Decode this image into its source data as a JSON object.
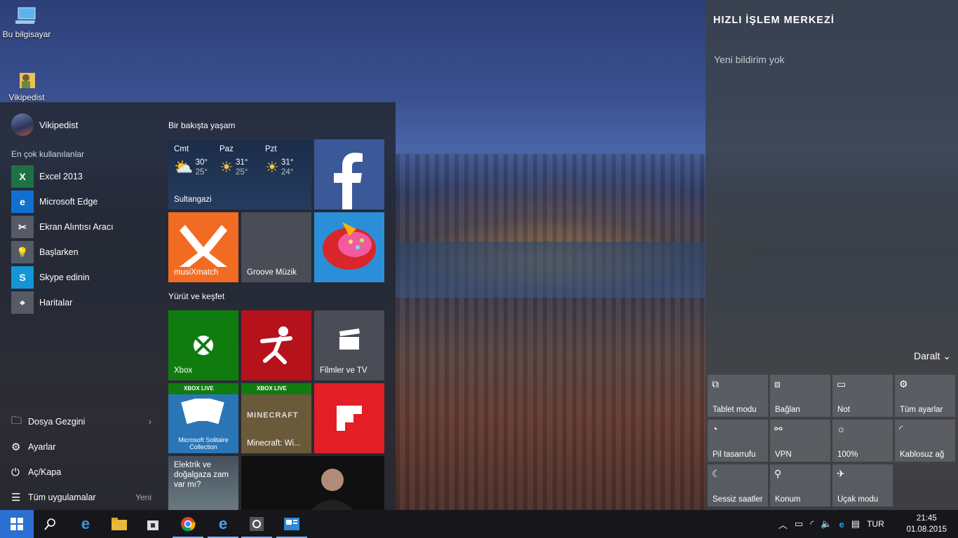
{
  "desktop": {
    "icons": [
      {
        "label": "Bu bilgisayar",
        "icon": "computer-icon"
      },
      {
        "label": "Vikipedist",
        "icon": "user-folder-icon"
      }
    ]
  },
  "start_menu": {
    "user_name": "Vikipedist",
    "most_used_label": "En çok kullanılanlar",
    "apps": [
      {
        "label": "Excel 2013",
        "icon": "excel-icon",
        "color": "#1e7145"
      },
      {
        "label": "Microsoft Edge",
        "icon": "edge-icon",
        "color": "#1070d1"
      },
      {
        "label": "Ekran Alıntısı Aracı",
        "icon": "scissors-icon",
        "color": "#555a66"
      },
      {
        "label": "Başlarken",
        "icon": "lightbulb-icon",
        "color": "#555a66"
      },
      {
        "label": "Skype edinin",
        "icon": "skype-icon",
        "color": "#1495d6"
      },
      {
        "label": "Haritalar",
        "icon": "map-pin-icon",
        "color": "#555a66"
      }
    ],
    "bottom": [
      {
        "label": "Dosya Gezgini",
        "icon": "folder-icon",
        "extra": "›"
      },
      {
        "label": "Ayarlar",
        "icon": "gear-icon",
        "extra": ""
      },
      {
        "label": "Aç/Kapa",
        "icon": "power-icon",
        "extra": ""
      },
      {
        "label": "Tüm uygulamalar",
        "icon": "list-icon",
        "extra": "Yeni"
      }
    ],
    "group1_title": "Bir bakışta yaşam",
    "group2_title": "Yürüt ve keşfet",
    "weather": {
      "location": "Sultangazi",
      "days": [
        {
          "day": "Cmt",
          "high": "30°",
          "low": "25°",
          "icon": "partly-cloudy-icon"
        },
        {
          "day": "Paz",
          "high": "31°",
          "low": "25°",
          "icon": "sun-icon"
        },
        {
          "day": "Pzt",
          "high": "31°",
          "low": "24°",
          "icon": "sun-icon"
        }
      ]
    },
    "tiles": {
      "facebook": "facebook-icon",
      "musixmatch": "musiXmatch",
      "groove": "Groove Müzik",
      "candy": "candy-crush-icon",
      "xbox": "Xbox",
      "filmler": "Filmler ve TV",
      "xboxlive1": "XBOX LIVE",
      "solitaire": "Microsoft Solitaire Collection",
      "xboxlive2": "XBOX LIVE",
      "minecraft": "Minecraft: Wi...",
      "minecraft_logo": "MINECRAFT",
      "news": "Elektrik ve doğalgaza zam var mı?"
    },
    "colors": {
      "xbox": "#107c10",
      "red": "#c50f1f",
      "musix": "#f26b22",
      "facebook": "#3b5998"
    }
  },
  "action_center": {
    "title": "HIZLI İŞLEM MERKEZİ",
    "no_notifications": "Yeni bildirim yok",
    "collapse": "Daralt",
    "quick_actions": [
      {
        "label": "Tablet modu",
        "icon": "tablet-icon"
      },
      {
        "label": "Bağlan",
        "icon": "connect-icon"
      },
      {
        "label": "Not",
        "icon": "note-icon"
      },
      {
        "label": "Tüm ayarlar",
        "icon": "gear-icon"
      },
      {
        "label": "Pil tasarrufu",
        "icon": "battery-saver-icon"
      },
      {
        "label": "VPN",
        "icon": "vpn-icon"
      },
      {
        "label": "100%",
        "icon": "brightness-icon"
      },
      {
        "label": "Kablosuz ağ",
        "icon": "wifi-icon"
      },
      {
        "label": "Sessiz saatler",
        "icon": "moon-icon"
      },
      {
        "label": "Konum",
        "icon": "location-icon"
      },
      {
        "label": "Uçak modu",
        "icon": "airplane-icon"
      }
    ]
  },
  "taskbar": {
    "apps": [
      "windows-logo-icon",
      "search-icon",
      "edge-icon",
      "file-explorer-icon",
      "store-icon",
      "chrome-icon",
      "ie-icon",
      "settings-app-icon",
      "photos-app-icon"
    ],
    "language": "TUR",
    "time": "21:45",
    "date": "01.08.2015"
  }
}
